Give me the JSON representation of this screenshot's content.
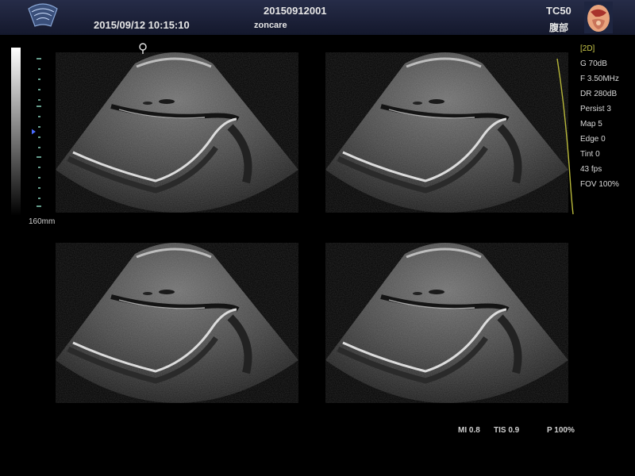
{
  "header": {
    "datetime": "2015/09/12 10:15:10",
    "patient_id": "20150912001",
    "hospital": "zoncare",
    "probe": "TC50",
    "exam": "腹部"
  },
  "depth_scale": {
    "label": "160mm"
  },
  "params": {
    "mode": "[2D]",
    "items": [
      "G 70dB",
      "F 3.50MHz",
      "DR 280dB",
      "Persist 3",
      "Map 5",
      "Edge 0",
      "Tint 0",
      "43 fps",
      "FOV 100%"
    ]
  },
  "bottom": {
    "mi": "MI 0.8",
    "tis": "TIS 0.9",
    "power": "P 100%"
  },
  "images": [
    {
      "name": "ultrasound-image-top-left"
    },
    {
      "name": "ultrasound-image-top-right"
    },
    {
      "name": "ultrasound-image-bottom-left"
    },
    {
      "name": "ultrasound-image-bottom-right"
    }
  ],
  "colors": {
    "mode_label": "#c9c84a",
    "focus_curve": "#b8b83a",
    "header_bg": "#1c2138"
  }
}
